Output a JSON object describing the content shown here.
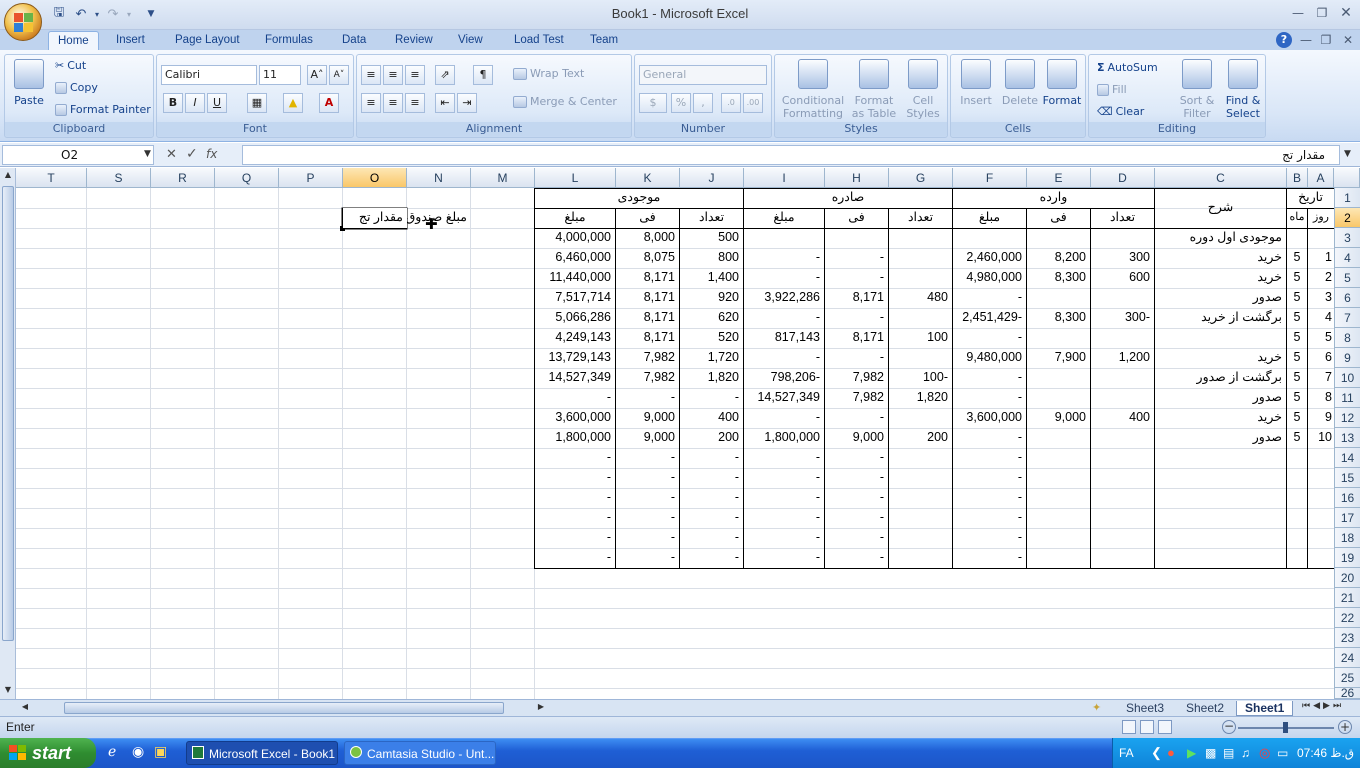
{
  "window": {
    "title": "Book1 - Microsoft Excel"
  },
  "qat": {
    "save": "save-icon",
    "undo": "undo-icon",
    "redo": "redo-icon"
  },
  "tabs": [
    "Home",
    "Insert",
    "Page Layout",
    "Formulas",
    "Data",
    "Review",
    "View",
    "Load Test",
    "Team"
  ],
  "clipboard": {
    "paste": "Paste",
    "cut": "Cut",
    "copy": "Copy",
    "format_painter": "Format Painter",
    "label": "Clipboard"
  },
  "font": {
    "name": "Calibri",
    "size": "11",
    "bold": "B",
    "italic": "I",
    "underline": "U",
    "label": "Font"
  },
  "alignment": {
    "wrap": "Wrap Text",
    "merge": "Merge & Center",
    "label": "Alignment"
  },
  "number": {
    "format": "General",
    "label": "Number"
  },
  "styles": {
    "conditional": "Conditional Formatting",
    "format_table": "Format as Table",
    "cell_styles": "Cell Styles",
    "label": "Styles"
  },
  "cells": {
    "insert": "Insert",
    "delete": "Delete",
    "format": "Format",
    "label": "Cells"
  },
  "editing": {
    "autosum": "AutoSum",
    "fill": "Fill",
    "clear": "Clear",
    "sort": "Sort & Filter",
    "find": "Find & Select",
    "label": "Editing"
  },
  "formula": {
    "name_box": "O2",
    "fx": "fx",
    "content": "مقدار تج"
  },
  "columns": [
    "T",
    "S",
    "R",
    "Q",
    "P",
    "O",
    "N",
    "M",
    "L",
    "K",
    "J",
    "I",
    "H",
    "G",
    "F",
    "E",
    "D",
    "C",
    "B",
    "A"
  ],
  "rows": [
    "1",
    "2",
    "3",
    "4",
    "5",
    "6",
    "7",
    "8",
    "9",
    "10",
    "11",
    "12",
    "13",
    "14",
    "15",
    "16",
    "17",
    "18",
    "19",
    "20",
    "21",
    "22",
    "23",
    "24",
    "25",
    "26"
  ],
  "headers": {
    "stock": "موجودی",
    "out": "صادره",
    "in": "وارده",
    "desc": "شرح",
    "date": "تاریخ",
    "amount": "مبلغ",
    "fee": "فی",
    "count": "تعداد",
    "day": "روز",
    "month": "ماه",
    "n2": "مبلغ صندوق",
    "o2": "مقدار تج"
  },
  "table_rows": [
    {
      "row": "3",
      "desc": "موجودی اول دوره",
      "d": "",
      "e": "",
      "f": "",
      "g": "",
      "h": "",
      "i": "",
      "j": "500",
      "k": "8,000",
      "l": "4,000,000",
      "b": "",
      "a": ""
    },
    {
      "row": "4",
      "desc": "خرید",
      "d": "300",
      "e": "8,200",
      "f": "2,460,000",
      "g": "",
      "h": "-",
      "i": "-",
      "j": "800",
      "k": "8,075",
      "l": "6,460,000",
      "b": "5",
      "a": "1"
    },
    {
      "row": "5",
      "desc": "خرید",
      "d": "600",
      "e": "8,300",
      "f": "4,980,000",
      "g": "",
      "h": "-",
      "i": "-",
      "j": "1,400",
      "k": "8,171",
      "l": "11,440,000",
      "b": "5",
      "a": "2"
    },
    {
      "row": "6",
      "desc": "صدور",
      "d": "",
      "e": "",
      "f": "-",
      "g": "480",
      "h": "8,171",
      "i": "3,922,286",
      "j": "920",
      "k": "8,171",
      "l": "7,517,714",
      "b": "5",
      "a": "3"
    },
    {
      "row": "7",
      "desc": "برگشت از خرید",
      "d": "300-",
      "e": "8,300",
      "f": "2,451,429-",
      "g": "",
      "h": "-",
      "i": "-",
      "j": "620",
      "k": "8,171",
      "l": "5,066,286",
      "b": "5",
      "a": "4"
    },
    {
      "row": "8",
      "desc": "",
      "d": "",
      "e": "",
      "f": "-",
      "g": "100",
      "h": "8,171",
      "i": "817,143",
      "j": "520",
      "k": "8,171",
      "l": "4,249,143",
      "b": "5",
      "a": "5"
    },
    {
      "row": "9",
      "desc": "خرید",
      "d": "1,200",
      "e": "7,900",
      "f": "9,480,000",
      "g": "",
      "h": "-",
      "i": "-",
      "j": "1,720",
      "k": "7,982",
      "l": "13,729,143",
      "b": "5",
      "a": "6"
    },
    {
      "row": "10",
      "desc": "برگشت از صدور",
      "d": "",
      "e": "",
      "f": "-",
      "g": "100-",
      "h": "7,982",
      "i": "798,206-",
      "j": "1,820",
      "k": "7,982",
      "l": "14,527,349",
      "b": "5",
      "a": "7"
    },
    {
      "row": "11",
      "desc": "صدور",
      "d": "",
      "e": "",
      "f": "-",
      "g": "1,820",
      "h": "7,982",
      "i": "14,527,349",
      "j": "-",
      "k": "-",
      "l": "-",
      "b": "5",
      "a": "8"
    },
    {
      "row": "12",
      "desc": "خرید",
      "d": "400",
      "e": "9,000",
      "f": "3,600,000",
      "g": "",
      "h": "-",
      "i": "-",
      "j": "400",
      "k": "9,000",
      "l": "3,600,000",
      "b": "5",
      "a": "9"
    },
    {
      "row": "13",
      "desc": "صدور",
      "d": "",
      "e": "",
      "f": "-",
      "g": "200",
      "h": "9,000",
      "i": "1,800,000",
      "j": "200",
      "k": "9,000",
      "l": "1,800,000",
      "b": "5",
      "a": "10"
    },
    {
      "row": "14",
      "desc": "",
      "d": "",
      "e": "",
      "f": "-",
      "g": "",
      "h": "-",
      "i": "-",
      "j": "-",
      "k": "-",
      "l": "-",
      "b": "",
      "a": ""
    },
    {
      "row": "15",
      "desc": "",
      "d": "",
      "e": "",
      "f": "-",
      "g": "",
      "h": "-",
      "i": "-",
      "j": "-",
      "k": "-",
      "l": "-",
      "b": "",
      "a": ""
    },
    {
      "row": "16",
      "desc": "",
      "d": "",
      "e": "",
      "f": "-",
      "g": "",
      "h": "-",
      "i": "-",
      "j": "-",
      "k": "-",
      "l": "-",
      "b": "",
      "a": ""
    },
    {
      "row": "17",
      "desc": "",
      "d": "",
      "e": "",
      "f": "-",
      "g": "",
      "h": "-",
      "i": "-",
      "j": "-",
      "k": "-",
      "l": "-",
      "b": "",
      "a": ""
    },
    {
      "row": "18",
      "desc": "",
      "d": "",
      "e": "",
      "f": "-",
      "g": "",
      "h": "-",
      "i": "-",
      "j": "-",
      "k": "-",
      "l": "-",
      "b": "",
      "a": ""
    },
    {
      "row": "19",
      "desc": "",
      "d": "",
      "e": "",
      "f": "-",
      "g": "",
      "h": "-",
      "i": "-",
      "j": "-",
      "k": "-",
      "l": "-",
      "b": "",
      "a": ""
    }
  ],
  "sheets": [
    "Sheet3",
    "Sheet2",
    "Sheet1"
  ],
  "status": {
    "mode": "Enter"
  },
  "taskbar": {
    "start": "start",
    "items": [
      "Microsoft Excel - Book1",
      "Camtasia Studio - Unt..."
    ],
    "lang": "FA",
    "clock": "07:46 ق.ظ"
  }
}
